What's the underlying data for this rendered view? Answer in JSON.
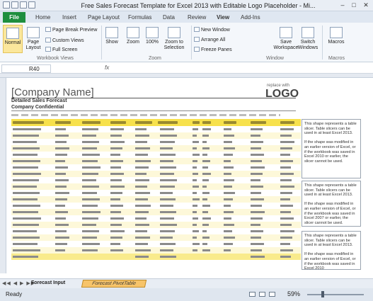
{
  "title_bar": {
    "title": "Free Sales Forecast Template for Excel 2013 with Editable Logo Placeholder - Mi...",
    "minimize": "–",
    "maximize": "□",
    "close": "✕"
  },
  "tabs": {
    "file": "File",
    "items": [
      "Home",
      "Insert",
      "Page Layout",
      "Formulas",
      "Data",
      "Review",
      "View",
      "Add-Ins"
    ]
  },
  "ribbon": {
    "normal": "Normal",
    "page_layout": "Page Layout",
    "page_break_preview": "Page Break Preview",
    "custom_views": "Custom Views",
    "full_screen": "Full Screen",
    "workbook_views_group": "Workbook Views",
    "show": "Show",
    "zoom": "Zoom",
    "zoom_100": "100%",
    "zoom_to_selection": "Zoom to Selection",
    "zoom_group": "Zoom",
    "new_window": "New Window",
    "arrange_all": "Arrange All",
    "freeze_panes": "Freeze Panes",
    "save_workspace": "Save Workspace",
    "switch_windows": "Switch Windows",
    "window_group": "Window",
    "macros": "Macros",
    "macros_group": "Macros"
  },
  "formula_bar": {
    "name_box": "R40",
    "fx": "fx"
  },
  "sheet": {
    "company_name": "[Company Name]",
    "report_title": "Detailed Sales Forecast",
    "confidential": "Company Confidential",
    "logo_small": "replace with",
    "logo": "LOGO"
  },
  "slicer_notes": [
    "This shape represents a table slicer. Table slicers can be used in at least Excel 2013.\n\nIf the shape was modified in an earlier version of Excel, or if the workbook was saved in Excel 2010 or earlier, the slicer cannot be used.",
    "This shape represents a table slicer. Table slicers can be used in at least Excel 2013.\n\nIf the shape was modified in an earlier version of Excel, or if the workbook was saved in Excel 2007 or earlier, the slicer cannot be used.",
    "This shape represents a table slicer. Table slicers can be used in at least Excel 2013.\n\nIf the shape was modified in an earlier version of Excel, or if the workbook was saved in Excel 2010"
  ],
  "sheet_tabs": {
    "nav": "◀◀ ◀ ▶ ▶▶",
    "active": "Forecast Input",
    "second": "Forecast PivotTable"
  },
  "status": {
    "ready": "Ready",
    "zoom": "59%",
    "zoom_level": 0.59
  },
  "colors": {
    "file_tab": "#1e8e3e",
    "table_header": "#f7e14c",
    "active_view": "#fbe79c",
    "pivot_tab": "#f7c46a"
  }
}
